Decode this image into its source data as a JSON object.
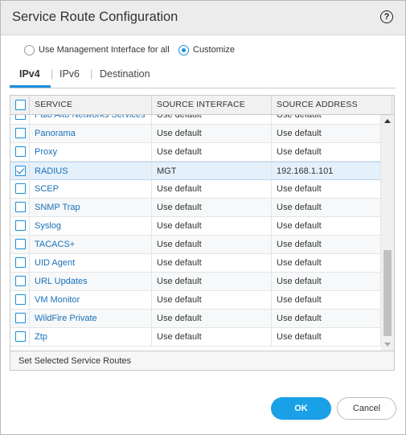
{
  "dialog": {
    "title": "Service Route Configuration",
    "help_glyph": "?"
  },
  "options": {
    "mgmt_label": "Use Management Interface for all",
    "customize_label": "Customize",
    "selected": "customize"
  },
  "tabs": [
    {
      "label": "IPv4",
      "active": true
    },
    {
      "label": "IPv6",
      "active": false
    },
    {
      "label": "Destination",
      "active": false
    }
  ],
  "table": {
    "columns": [
      "SERVICE",
      "SOURCE INTERFACE",
      "SOURCE ADDRESS"
    ],
    "rows": [
      {
        "service": "Palo Alto Networks Services",
        "interface": "Use default",
        "address": "Use default",
        "checked": false
      },
      {
        "service": "Panorama",
        "interface": "Use default",
        "address": "Use default",
        "checked": false
      },
      {
        "service": "Proxy",
        "interface": "Use default",
        "address": "Use default",
        "checked": false
      },
      {
        "service": "RADIUS",
        "interface": "MGT",
        "address": "192.168.1.101",
        "checked": true
      },
      {
        "service": "SCEP",
        "interface": "Use default",
        "address": "Use default",
        "checked": false
      },
      {
        "service": "SNMP Trap",
        "interface": "Use default",
        "address": "Use default",
        "checked": false
      },
      {
        "service": "Syslog",
        "interface": "Use default",
        "address": "Use default",
        "checked": false
      },
      {
        "service": "TACACS+",
        "interface": "Use default",
        "address": "Use default",
        "checked": false
      },
      {
        "service": "UID Agent",
        "interface": "Use default",
        "address": "Use default",
        "checked": false
      },
      {
        "service": "URL Updates",
        "interface": "Use default",
        "address": "Use default",
        "checked": false
      },
      {
        "service": "VM Monitor",
        "interface": "Use default",
        "address": "Use default",
        "checked": false
      },
      {
        "service": "WildFire Private",
        "interface": "Use default",
        "address": "Use default",
        "checked": false
      },
      {
        "service": "Ztp",
        "interface": "Use default",
        "address": "Use default",
        "checked": false
      }
    ],
    "footer_action": "Set Selected Service Routes"
  },
  "buttons": {
    "ok": "OK",
    "cancel": "Cancel"
  },
  "colors": {
    "accent": "#19a0e6",
    "link": "#1a70b8",
    "selected_row": "#e4f0fa"
  }
}
